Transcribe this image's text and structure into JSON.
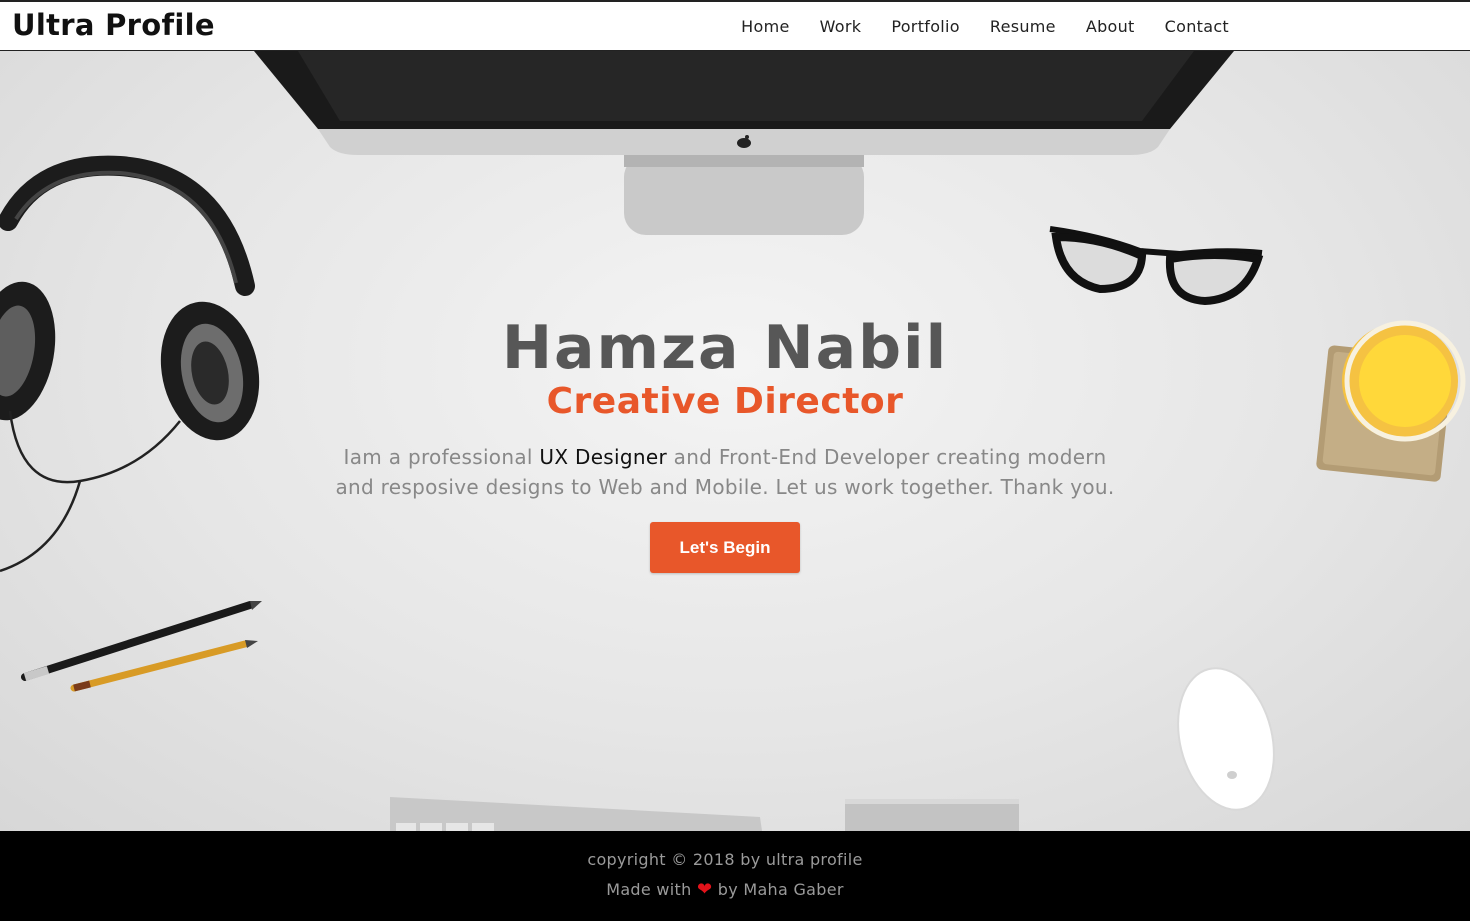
{
  "header": {
    "logo": "Ultra Profile",
    "nav": [
      "Home",
      "Work",
      "Portfolio",
      "Resume",
      "About",
      "Contact"
    ]
  },
  "hero": {
    "name": "Hamza Nabil",
    "role": "Creative Director",
    "intro_before": "Iam a professional ",
    "intro_highlight": "UX Designer",
    "intro_after": " and Front-End Developer creating modern and resposive designs to Web and Mobile. Let us work together. Thank you.",
    "cta_label": "Let's Begin"
  },
  "footer": {
    "copyright": "copyright © 2018 by ultra profile",
    "made_with": "Made with",
    "by": "by Maha Gaber"
  },
  "colors": {
    "accent": "#e8572a",
    "name": "#575757",
    "footer_bg": "#000000",
    "heart": "#e3121a"
  },
  "icons": [
    "heart-icon",
    "apple-logo-icon"
  ]
}
